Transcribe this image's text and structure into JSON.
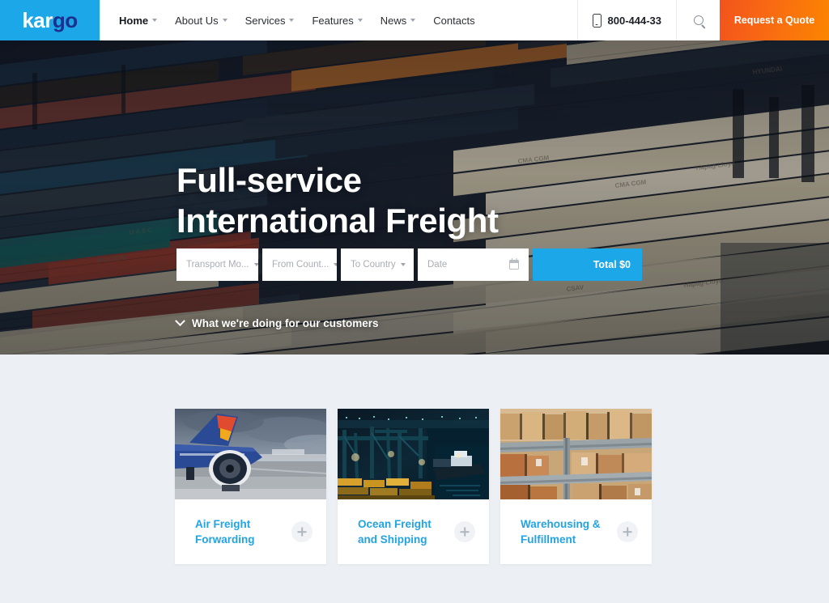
{
  "brand": {
    "logo_primary": "kar",
    "logo_secondary": "go",
    "logo_bg": "#1ca7e8",
    "logo_primary_color": "#ffffff",
    "logo_secondary_color": "#1b2f8f"
  },
  "header": {
    "nav": [
      {
        "label": "Home",
        "has_dropdown": true,
        "active": true
      },
      {
        "label": "About Us",
        "has_dropdown": true,
        "active": false
      },
      {
        "label": "Services",
        "has_dropdown": true,
        "active": false
      },
      {
        "label": "Features",
        "has_dropdown": true,
        "active": false
      },
      {
        "label": "News",
        "has_dropdown": true,
        "active": false
      },
      {
        "label": "Contacts",
        "has_dropdown": false,
        "active": false
      }
    ],
    "phone": "800-444-33",
    "phone_icon": "mobile-phone-icon",
    "search_icon": "search-icon",
    "quote_label": "Request a Quote",
    "quote_color": "#f8670f"
  },
  "hero": {
    "title_line1": "Full-service",
    "title_line2": "International Freight",
    "scroll_hint": "What we're doing for our customers",
    "scroll_icon": "chevron-down-icon",
    "form": {
      "transport_mode": "Transport Mo...",
      "from_country": "From Count...",
      "to_country": "To Country",
      "date": "Date",
      "date_icon": "calendar-icon",
      "total_label": "Total $0",
      "total_color": "#1ca7e8"
    }
  },
  "services": {
    "bg_color": "#eceff3",
    "title_color": "#22a3e2",
    "cards": [
      {
        "title": "Air Freight\nForwarding",
        "image_alt": "airplane-on-tarmac-photo",
        "expand_icon": "plus-icon"
      },
      {
        "title": "Ocean Freight\nand Shipping",
        "image_alt": "night-container-port-photo",
        "expand_icon": "plus-icon"
      },
      {
        "title": "Warehousing &\nFulfillment",
        "image_alt": "warehouse-shelves-boxes-photo",
        "expand_icon": "plus-icon"
      }
    ]
  }
}
